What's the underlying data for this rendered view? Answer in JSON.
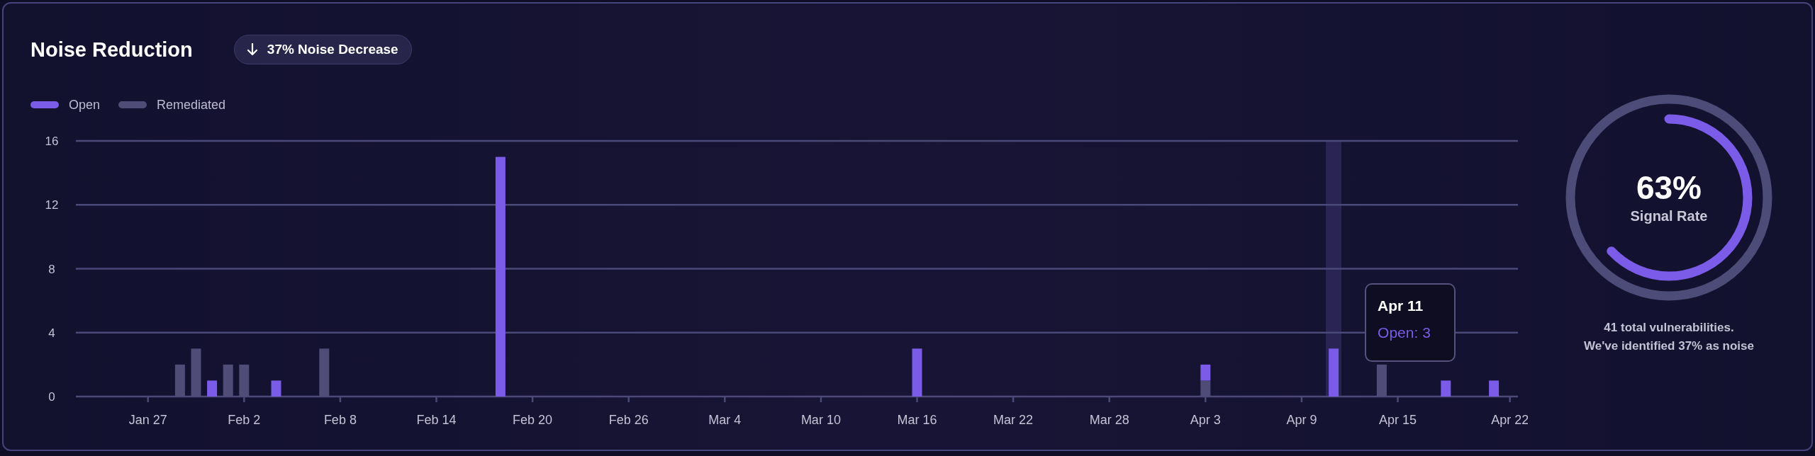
{
  "title": "Noise Reduction",
  "badge": {
    "text": "37% Noise Decrease"
  },
  "chart": {
    "chart_data": {
      "type": "bar",
      "stacked": true,
      "grid": true,
      "categories": [
        null,
        null,
        null,
        null,
        "Jan 27",
        null,
        null,
        null,
        null,
        null,
        "Feb 2",
        null,
        null,
        null,
        null,
        null,
        "Feb 8",
        null,
        null,
        null,
        null,
        null,
        "Feb 14",
        null,
        null,
        null,
        null,
        null,
        "Feb 20",
        null,
        null,
        null,
        null,
        null,
        "Feb 26",
        null,
        null,
        null,
        null,
        null,
        "Mar 4",
        null,
        null,
        null,
        null,
        null,
        "Mar 10",
        null,
        null,
        null,
        null,
        null,
        "Mar 16",
        null,
        null,
        null,
        null,
        null,
        "Mar 22",
        null,
        null,
        null,
        null,
        null,
        "Mar 28",
        null,
        null,
        null,
        null,
        null,
        "Apr 3",
        null,
        null,
        null,
        null,
        null,
        "Apr 9",
        null,
        null,
        null,
        null,
        null,
        "Apr 15",
        null,
        null,
        null,
        null,
        null,
        null,
        "Apr 22"
      ],
      "series": [
        {
          "name": "Open",
          "color": "#7b5ce8",
          "values": [
            0,
            0,
            0,
            0,
            0,
            0,
            0,
            0,
            1,
            0,
            0,
            0,
            1,
            0,
            0,
            0,
            0,
            0,
            0,
            0,
            0,
            0,
            0,
            0,
            0,
            0,
            15,
            0,
            0,
            0,
            0,
            0,
            0,
            0,
            0,
            0,
            0,
            0,
            0,
            0,
            0,
            0,
            0,
            0,
            0,
            0,
            0,
            0,
            0,
            0,
            0,
            0,
            3,
            0,
            0,
            0,
            0,
            0,
            0,
            0,
            0,
            0,
            0,
            0,
            0,
            0,
            0,
            0,
            0,
            0,
            1,
            0,
            0,
            0,
            0,
            0,
            0,
            0,
            3,
            0,
            0,
            0,
            0,
            0,
            0,
            1,
            0,
            0,
            1,
            0
          ]
        },
        {
          "name": "Remediated",
          "color": "#4f4d78",
          "values": [
            0,
            0,
            0,
            0,
            0,
            0,
            2,
            3,
            0,
            2,
            2,
            0,
            0,
            0,
            0,
            3,
            0,
            0,
            0,
            0,
            0,
            0,
            0,
            0,
            0,
            0,
            0,
            0,
            0,
            0,
            0,
            0,
            0,
            0,
            0,
            0,
            0,
            0,
            0,
            0,
            0,
            0,
            0,
            0,
            0,
            0,
            0,
            0,
            0,
            0,
            0,
            0,
            0,
            0,
            0,
            0,
            0,
            0,
            0,
            0,
            0,
            0,
            0,
            0,
            0,
            0,
            0,
            0,
            0,
            0,
            1,
            0,
            0,
            0,
            0,
            0,
            0,
            0,
            0,
            0,
            0,
            2,
            0,
            0,
            0,
            0,
            0,
            0,
            0,
            0
          ]
        }
      ],
      "ylim": [
        0,
        16
      ],
      "yticks": [
        0,
        4,
        8,
        12,
        16
      ]
    },
    "tooltip": {
      "title": "Apr 11",
      "text": "Open: 3"
    }
  },
  "signal_ring": {
    "level": 0.63,
    "value": "63%",
    "label": "Signal Rate"
  },
  "summary": [
    "41 total vulnerabilities.",
    "We've identified 37% as noise"
  ]
}
